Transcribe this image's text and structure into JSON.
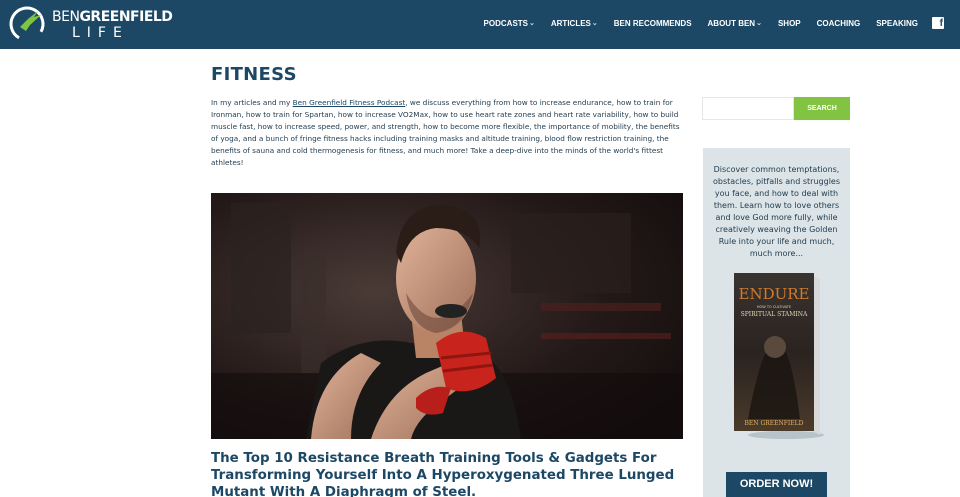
{
  "header": {
    "logo": {
      "line1_bold_a": "BEN",
      "line1_rest": "GREENFIELD",
      "line2": "LIFE"
    },
    "nav": [
      {
        "label": "PODCASTS",
        "dropdown": true
      },
      {
        "label": "ARTICLES",
        "dropdown": true
      },
      {
        "label": "BEN RECOMMENDS",
        "dropdown": false
      },
      {
        "label": "ABOUT BEN",
        "dropdown": true
      },
      {
        "label": "SHOP",
        "dropdown": false
      },
      {
        "label": "COACHING",
        "dropdown": false
      },
      {
        "label": "SPEAKING",
        "dropdown": false
      }
    ],
    "social_icon": "f"
  },
  "main": {
    "page_title": "FITNESS",
    "intro_before_link": "In my articles and my ",
    "intro_link": "Ben Greenfield Fitness Podcast",
    "intro_after_link": ", we discuss everything from how to increase endurance, how to train for Ironman, how to train for Spartan, how to increase VO2Max, how to use heart rate zones and heart rate variability, how to build muscle fast, how to increase speed, power, and strength, how to become more flexible, the importance of mobility, the benefits of yoga, and a bunch of fringe fitness hacks including training masks and altitude training, blood flow restriction training, the benefits of sauna and cold thermogenesis for fitness, and much more! Take a deep-dive into the minds of the world's fittest athletes!",
    "post_title": "The Top 10 Resistance Breath Training Tools & Gadgets For Transforming Yourself Into A Hyperoxygenated Three Lunged Mutant With A Diaphragm of Steel."
  },
  "sidebar": {
    "search_placeholder": "",
    "search_button": "SEARCH",
    "promo_text": "Discover common temptations, obstacles, pitfalls and struggles you face, and how to deal with them. Learn how to love others and love God more fully, while creatively weaving the Golden Rule into your life and much, much more...",
    "book": {
      "title": "ENDURE",
      "subtitle_line1": "HOW TO CULTIVATE",
      "subtitle_line2": "SPIRITUAL STAMINA",
      "author": "BEN GREENFIELD"
    },
    "order_button": "ORDER NOW!"
  },
  "colors": {
    "header_bg": "#1c4866",
    "accent_green": "#82c341",
    "promo_bg": "#dce4e8",
    "title_blue": "#1c4866"
  }
}
